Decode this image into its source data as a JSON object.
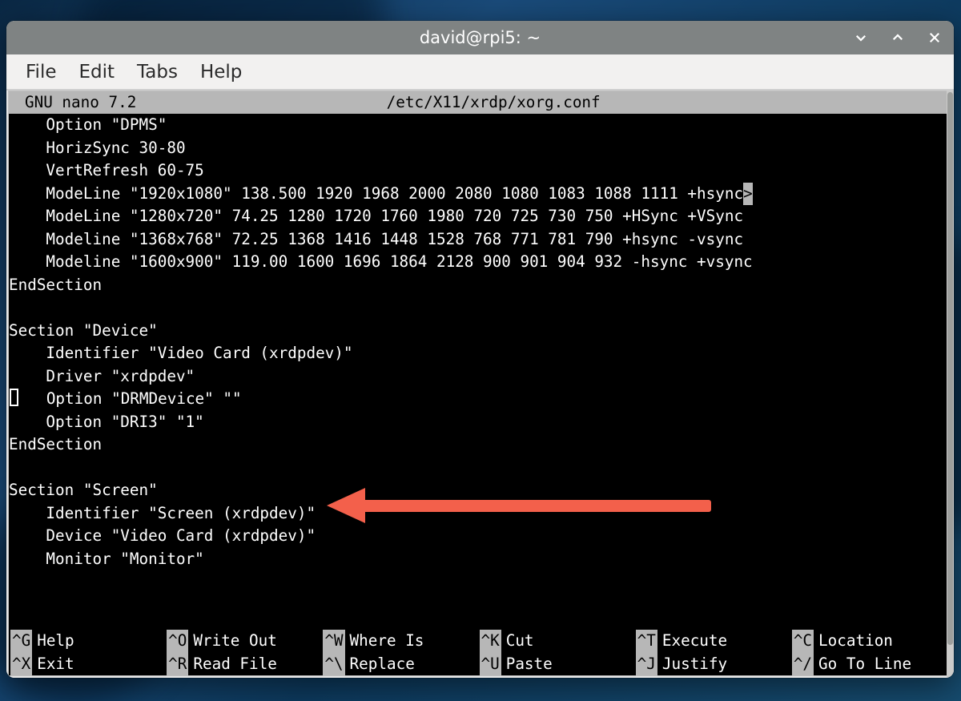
{
  "window": {
    "title": "david@rpi5: ~"
  },
  "menubar": {
    "items": [
      "File",
      "Edit",
      "Tabs",
      "Help"
    ]
  },
  "nano": {
    "app": "GNU nano 7.2",
    "filepath": "/etc/X11/xrdp/xorg.conf",
    "overflow_marker": ">",
    "lines": [
      "    Option \"DPMS\"",
      "    HorizSync 30-80",
      "    VertRefresh 60-75",
      "    ModeLine \"1920x1080\" 138.500 1920 1968 2000 2080 1080 1083 1088 1111 +hsync",
      "    ModeLine \"1280x720\" 74.25 1280 1720 1760 1980 720 725 730 750 +HSync +VSync",
      "    Modeline \"1368x768\" 72.25 1368 1416 1448 1528 768 771 781 790 +hsync -vsync",
      "    Modeline \"1600x900\" 119.00 1600 1696 1864 2128 900 901 904 932 -hsync +vsync",
      "EndSection",
      "",
      "Section \"Device\"",
      "    Identifier \"Video Card (xrdpdev)\"",
      "    Driver \"xrdpdev\"",
      "    Option \"DRMDevice\" \"\"",
      "    Option \"DRI3\" \"1\"",
      "EndSection",
      "",
      "Section \"Screen\"",
      "    Identifier \"Screen (xrdpdev)\"",
      "    Device \"Video Card (xrdpdev)\"",
      "    Monitor \"Monitor\""
    ],
    "cursor_line": 12,
    "overflow_line": 3,
    "footer": [
      {
        "key": "^G",
        "label": "Help"
      },
      {
        "key": "^O",
        "label": "Write Out"
      },
      {
        "key": "^W",
        "label": "Where Is"
      },
      {
        "key": "^K",
        "label": "Cut"
      },
      {
        "key": "^T",
        "label": "Execute"
      },
      {
        "key": "^C",
        "label": "Location"
      },
      {
        "key": "^X",
        "label": "Exit"
      },
      {
        "key": "^R",
        "label": "Read File"
      },
      {
        "key": "^\\",
        "label": "Replace"
      },
      {
        "key": "^U",
        "label": "Paste"
      },
      {
        "key": "^J",
        "label": "Justify"
      },
      {
        "key": "^/",
        "label": "Go To Line"
      }
    ]
  }
}
